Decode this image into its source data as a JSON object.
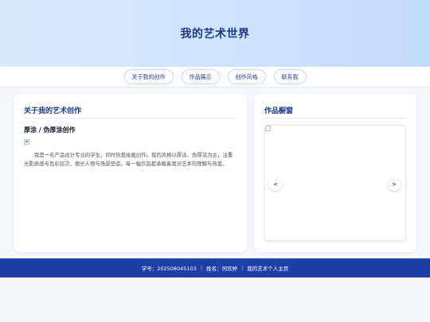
{
  "header": {
    "title": "我的艺术世界"
  },
  "nav": {
    "items": [
      {
        "label": "关于我的创作"
      },
      {
        "label": "作品展示"
      },
      {
        "label": "创作风格"
      },
      {
        "label": "联系我"
      }
    ]
  },
  "about": {
    "title": "关于我的艺术创作",
    "subtitle": "厚涂 / 伪厚涂创作",
    "bio": "我是一名产品设计专业的学生，同时热爱绘画创作。我的风格以厚涂、伪厚涂为主，注重光影质感与色彩层次，擅长人物与场景塑造。每一幅作品都承载着我对艺术的理解与热爱。"
  },
  "showcase": {
    "title": "作品橱窗",
    "prev_label": "<",
    "next_label": ">"
  },
  "footer": {
    "student_id": "学号：202508045103",
    "name": "姓名：何欣婷",
    "site": "我的艺术个人主页",
    "separator": "|"
  },
  "colors": {
    "primary": "#1e3a8a",
    "footer_bg": "#1d3fa6",
    "hero_gradient_start": "#dbe9fc",
    "hero_gradient_end": "#c3dbfb"
  }
}
